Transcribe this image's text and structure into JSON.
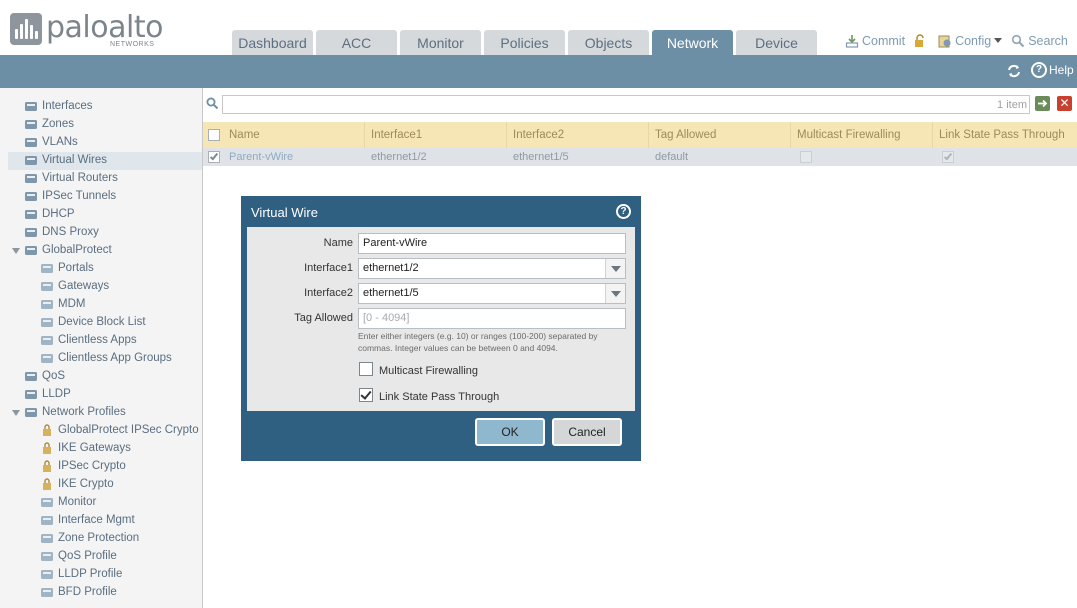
{
  "brand": {
    "name": "paloalto",
    "sub": "NETWORKS"
  },
  "tabs": [
    {
      "label": "Dashboard",
      "active": false
    },
    {
      "label": "ACC",
      "active": false
    },
    {
      "label": "Monitor",
      "active": false
    },
    {
      "label": "Policies",
      "active": false
    },
    {
      "label": "Objects",
      "active": false
    },
    {
      "label": "Network",
      "active": true
    },
    {
      "label": "Device",
      "active": false
    }
  ],
  "toplinks": {
    "commit": "Commit",
    "config": "Config",
    "search": "Search"
  },
  "toolbar": {
    "help": "Help"
  },
  "sidebar": {
    "items": [
      {
        "label": "Interfaces",
        "icon": "interfaces-icon",
        "indent": 0
      },
      {
        "label": "Zones",
        "icon": "zones-icon",
        "indent": 0
      },
      {
        "label": "VLANs",
        "icon": "vlans-icon",
        "indent": 0
      },
      {
        "label": "Virtual Wires",
        "icon": "virtual-wires-icon",
        "indent": 0,
        "selected": true
      },
      {
        "label": "Virtual Routers",
        "icon": "virtual-routers-icon",
        "indent": 0
      },
      {
        "label": "IPSec Tunnels",
        "icon": "ipsec-tunnels-icon",
        "indent": 0
      },
      {
        "label": "DHCP",
        "icon": "dhcp-icon",
        "indent": 0
      },
      {
        "label": "DNS Proxy",
        "icon": "dns-proxy-icon",
        "indent": 0
      },
      {
        "label": "GlobalProtect",
        "icon": "globalprotect-icon",
        "indent": 0,
        "expandable": true
      },
      {
        "label": "Portals",
        "icon": "portals-icon",
        "indent": 1
      },
      {
        "label": "Gateways",
        "icon": "gateways-icon",
        "indent": 1
      },
      {
        "label": "MDM",
        "icon": "mdm-icon",
        "indent": 1
      },
      {
        "label": "Device Block List",
        "icon": "device-block-list-icon",
        "indent": 1
      },
      {
        "label": "Clientless Apps",
        "icon": "clientless-apps-icon",
        "indent": 1
      },
      {
        "label": "Clientless App Groups",
        "icon": "clientless-app-groups-icon",
        "indent": 1
      },
      {
        "label": "QoS",
        "icon": "qos-icon",
        "indent": 0
      },
      {
        "label": "LLDP",
        "icon": "lldp-icon",
        "indent": 0
      },
      {
        "label": "Network Profiles",
        "icon": "network-profiles-icon",
        "indent": 0,
        "expandable": true
      },
      {
        "label": "GlobalProtect IPSec Crypto",
        "icon": "lock-icon",
        "indent": 1
      },
      {
        "label": "IKE Gateways",
        "icon": "lock-icon",
        "indent": 1
      },
      {
        "label": "IPSec Crypto",
        "icon": "lock-icon",
        "indent": 1
      },
      {
        "label": "IKE Crypto",
        "icon": "lock-icon",
        "indent": 1
      },
      {
        "label": "Monitor",
        "icon": "monitor-profile-icon",
        "indent": 1
      },
      {
        "label": "Interface Mgmt",
        "icon": "interface-mgmt-icon",
        "indent": 1
      },
      {
        "label": "Zone Protection",
        "icon": "zone-protection-icon",
        "indent": 1
      },
      {
        "label": "QoS Profile",
        "icon": "qos-profile-icon",
        "indent": 1
      },
      {
        "label": "LLDP Profile",
        "icon": "lldp-profile-icon",
        "indent": 1
      },
      {
        "label": "BFD Profile",
        "icon": "bfd-profile-icon",
        "indent": 1
      }
    ]
  },
  "filter": {
    "count": "1 item"
  },
  "table": {
    "columns": [
      "Name",
      "Interface1",
      "Interface2",
      "Tag Allowed",
      "Multicast Firewalling",
      "Link State Pass Through"
    ],
    "rows": [
      {
        "name": "Parent-vWire",
        "interface1": "ethernet1/2",
        "interface2": "ethernet1/5",
        "tag_allowed": "default",
        "multicast": false,
        "link_state": true,
        "checked": true
      }
    ]
  },
  "dialog": {
    "title": "Virtual Wire",
    "name_label": "Name",
    "name_value": "Parent-vWire",
    "if1_label": "Interface1",
    "if1_value": "ethernet1/2",
    "if2_label": "Interface2",
    "if2_value": "ethernet1/5",
    "tag_label": "Tag Allowed",
    "tag_placeholder": "[0 - 4094]",
    "hint": "Enter either integers (e.g. 10) or ranges (100-200) separated by commas. Integer values can be between 0 and 4094.",
    "multicast_label": "Multicast Firewalling",
    "multicast_checked": false,
    "linkstate_label": "Link State Pass Through",
    "linkstate_checked": true,
    "ok": "OK",
    "cancel": "Cancel"
  },
  "colors": {
    "header_bar": "#6d8fa6",
    "active_tab": "#6d8fa6",
    "dialog_frame": "#2f5f81",
    "table_header": "#f6e6b6",
    "ok_button": "#8fb8cf"
  }
}
